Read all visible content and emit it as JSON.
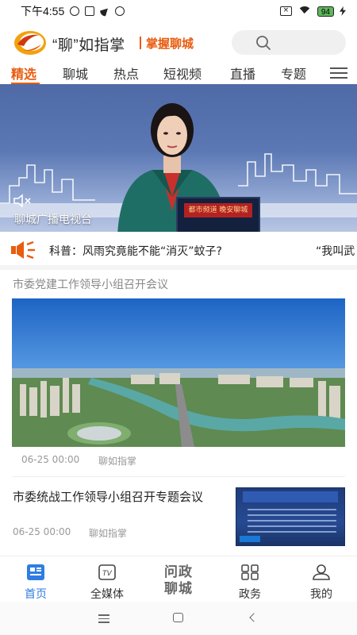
{
  "status_bar": {
    "time": "下午4:55",
    "battery": "94"
  },
  "header": {
    "brand": "“聊”如指掌",
    "slogan": "掌握聊城",
    "search_icon": "search-icon"
  },
  "tabs": [
    {
      "label": "精选",
      "active": true
    },
    {
      "label": "聊城"
    },
    {
      "label": "热点"
    },
    {
      "label": "短视频"
    },
    {
      "label": "直播"
    },
    {
      "label": "专题"
    }
  ],
  "hero": {
    "caption": "聊城广播电视台",
    "screen_title": "都市频道 晚安聊城"
  },
  "ticker": {
    "text": "科普：风雨究竟能不能“消灭”蚊子?",
    "text_next": "“我叫武"
  },
  "articles": [
    {
      "title": "市委党建工作领导小组召开会议",
      "date": "06-25 00:00",
      "source": "聊如指掌"
    },
    {
      "title": "市委统战工作领导小组召开专题会议",
      "date": "06-25 00:00",
      "source": "聊如指掌"
    }
  ],
  "bottom_nav": {
    "home": "首页",
    "media": "全媒体",
    "center_line1": "问政",
    "center_line2": "聊城",
    "gov": "政务",
    "mine": "我的"
  },
  "colors": {
    "accent": "#e85c0f",
    "nav_active": "#2f7de1"
  }
}
